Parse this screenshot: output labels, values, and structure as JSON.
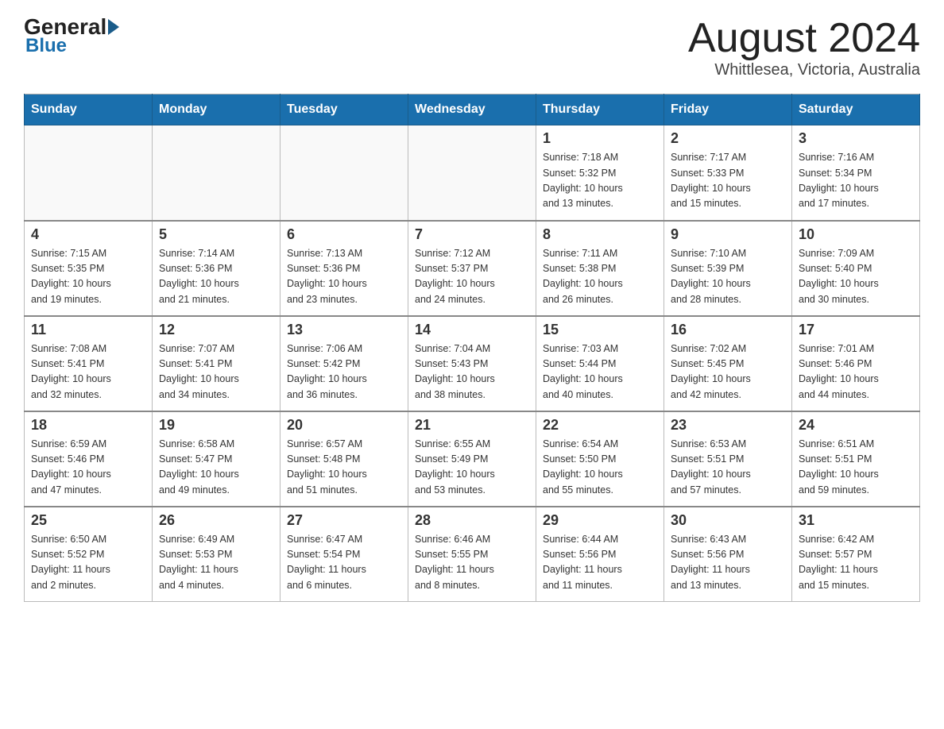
{
  "header": {
    "logo_general": "General",
    "logo_blue": "Blue",
    "month_title": "August 2024",
    "location": "Whittlesea, Victoria, Australia"
  },
  "days_of_week": [
    "Sunday",
    "Monday",
    "Tuesday",
    "Wednesday",
    "Thursday",
    "Friday",
    "Saturday"
  ],
  "weeks": [
    [
      {
        "day": "",
        "info": ""
      },
      {
        "day": "",
        "info": ""
      },
      {
        "day": "",
        "info": ""
      },
      {
        "day": "",
        "info": ""
      },
      {
        "day": "1",
        "info": "Sunrise: 7:18 AM\nSunset: 5:32 PM\nDaylight: 10 hours\nand 13 minutes."
      },
      {
        "day": "2",
        "info": "Sunrise: 7:17 AM\nSunset: 5:33 PM\nDaylight: 10 hours\nand 15 minutes."
      },
      {
        "day": "3",
        "info": "Sunrise: 7:16 AM\nSunset: 5:34 PM\nDaylight: 10 hours\nand 17 minutes."
      }
    ],
    [
      {
        "day": "4",
        "info": "Sunrise: 7:15 AM\nSunset: 5:35 PM\nDaylight: 10 hours\nand 19 minutes."
      },
      {
        "day": "5",
        "info": "Sunrise: 7:14 AM\nSunset: 5:36 PM\nDaylight: 10 hours\nand 21 minutes."
      },
      {
        "day": "6",
        "info": "Sunrise: 7:13 AM\nSunset: 5:36 PM\nDaylight: 10 hours\nand 23 minutes."
      },
      {
        "day": "7",
        "info": "Sunrise: 7:12 AM\nSunset: 5:37 PM\nDaylight: 10 hours\nand 24 minutes."
      },
      {
        "day": "8",
        "info": "Sunrise: 7:11 AM\nSunset: 5:38 PM\nDaylight: 10 hours\nand 26 minutes."
      },
      {
        "day": "9",
        "info": "Sunrise: 7:10 AM\nSunset: 5:39 PM\nDaylight: 10 hours\nand 28 minutes."
      },
      {
        "day": "10",
        "info": "Sunrise: 7:09 AM\nSunset: 5:40 PM\nDaylight: 10 hours\nand 30 minutes."
      }
    ],
    [
      {
        "day": "11",
        "info": "Sunrise: 7:08 AM\nSunset: 5:41 PM\nDaylight: 10 hours\nand 32 minutes."
      },
      {
        "day": "12",
        "info": "Sunrise: 7:07 AM\nSunset: 5:41 PM\nDaylight: 10 hours\nand 34 minutes."
      },
      {
        "day": "13",
        "info": "Sunrise: 7:06 AM\nSunset: 5:42 PM\nDaylight: 10 hours\nand 36 minutes."
      },
      {
        "day": "14",
        "info": "Sunrise: 7:04 AM\nSunset: 5:43 PM\nDaylight: 10 hours\nand 38 minutes."
      },
      {
        "day": "15",
        "info": "Sunrise: 7:03 AM\nSunset: 5:44 PM\nDaylight: 10 hours\nand 40 minutes."
      },
      {
        "day": "16",
        "info": "Sunrise: 7:02 AM\nSunset: 5:45 PM\nDaylight: 10 hours\nand 42 minutes."
      },
      {
        "day": "17",
        "info": "Sunrise: 7:01 AM\nSunset: 5:46 PM\nDaylight: 10 hours\nand 44 minutes."
      }
    ],
    [
      {
        "day": "18",
        "info": "Sunrise: 6:59 AM\nSunset: 5:46 PM\nDaylight: 10 hours\nand 47 minutes."
      },
      {
        "day": "19",
        "info": "Sunrise: 6:58 AM\nSunset: 5:47 PM\nDaylight: 10 hours\nand 49 minutes."
      },
      {
        "day": "20",
        "info": "Sunrise: 6:57 AM\nSunset: 5:48 PM\nDaylight: 10 hours\nand 51 minutes."
      },
      {
        "day": "21",
        "info": "Sunrise: 6:55 AM\nSunset: 5:49 PM\nDaylight: 10 hours\nand 53 minutes."
      },
      {
        "day": "22",
        "info": "Sunrise: 6:54 AM\nSunset: 5:50 PM\nDaylight: 10 hours\nand 55 minutes."
      },
      {
        "day": "23",
        "info": "Sunrise: 6:53 AM\nSunset: 5:51 PM\nDaylight: 10 hours\nand 57 minutes."
      },
      {
        "day": "24",
        "info": "Sunrise: 6:51 AM\nSunset: 5:51 PM\nDaylight: 10 hours\nand 59 minutes."
      }
    ],
    [
      {
        "day": "25",
        "info": "Sunrise: 6:50 AM\nSunset: 5:52 PM\nDaylight: 11 hours\nand 2 minutes."
      },
      {
        "day": "26",
        "info": "Sunrise: 6:49 AM\nSunset: 5:53 PM\nDaylight: 11 hours\nand 4 minutes."
      },
      {
        "day": "27",
        "info": "Sunrise: 6:47 AM\nSunset: 5:54 PM\nDaylight: 11 hours\nand 6 minutes."
      },
      {
        "day": "28",
        "info": "Sunrise: 6:46 AM\nSunset: 5:55 PM\nDaylight: 11 hours\nand 8 minutes."
      },
      {
        "day": "29",
        "info": "Sunrise: 6:44 AM\nSunset: 5:56 PM\nDaylight: 11 hours\nand 11 minutes."
      },
      {
        "day": "30",
        "info": "Sunrise: 6:43 AM\nSunset: 5:56 PM\nDaylight: 11 hours\nand 13 minutes."
      },
      {
        "day": "31",
        "info": "Sunrise: 6:42 AM\nSunset: 5:57 PM\nDaylight: 11 hours\nand 15 minutes."
      }
    ]
  ]
}
